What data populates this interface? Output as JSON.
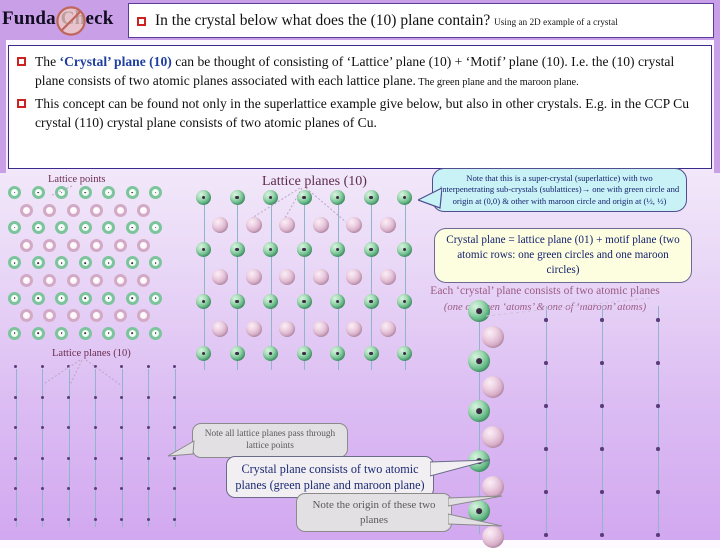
{
  "logo": {
    "text": "Funda Check",
    "icon": "no-entry-icon"
  },
  "header": {
    "bullet": "square-bullet-icon",
    "question": "In the crystal below what does the (10) plane contain?",
    "subnote": "Using an 2D example of a crystal"
  },
  "body": {
    "points": [
      {
        "pre": "The ",
        "highlight": "‘Crystal’ plane (10)",
        "main": " can be thought of consisting of ‘Lattice’ plane (10) + ‘Motif’ plane (10). I.e. the (10) crystal plane consists of two atomic planes associated with each lattice plane.",
        "small": " The green plane and the maroon plane."
      },
      {
        "pre": "",
        "highlight": "",
        "main": "This concept can be found not only in the superlattice example give below, but also in other crystals. E.g. in the CCP Cu crystal (110) crystal plane consists of two atomic planes of Cu.",
        "small": ""
      }
    ]
  },
  "captions": {
    "lattice_points": "Lattice points",
    "lattice_planes_top": "Lattice planes (10)",
    "lattice_planes_bottom": "Lattice planes (10)"
  },
  "annotations": {
    "crystal_plane_note_line1": "Each ‘crystal’ plane consists of two atomic planes",
    "crystal_plane_note_line2": "(one of green ‘atoms’ & one of ‘maroon’ atoms)"
  },
  "callouts": {
    "supercrystal": "Note that this is a super-crystal (superlattice) with two interpenetrating sub-crystals (sublattices)→ one with green circle and origin at (0,0) & other with maroon circle and origin at (½, ½)",
    "crystal_plane_eq": "Crystal plane = lattice plane (01) + motif plane (two atomic rows: one green circles and one maroon circles)",
    "all_planes": "Note all lattice planes pass through lattice points",
    "two_atomic": "Crystal plane consists of two atomic planes (green plane and maroon plane)",
    "origin": "Note the origin of these two planes"
  },
  "colors": {
    "band": "#c9a0e8",
    "green_atom": "#62b885",
    "maroon_atom": "#d9afc9",
    "lattice_point": "#5b3c7a",
    "plane_line": "#8fb4cc",
    "highlight_text": "#1f3fa0",
    "caption_text": "#6b2d4f",
    "callout_cyan": "#c9f2f7",
    "callout_yellow": "#fdfddf",
    "callout_gray": "#e3e0e3",
    "bullet_red": "#cc2222"
  }
}
